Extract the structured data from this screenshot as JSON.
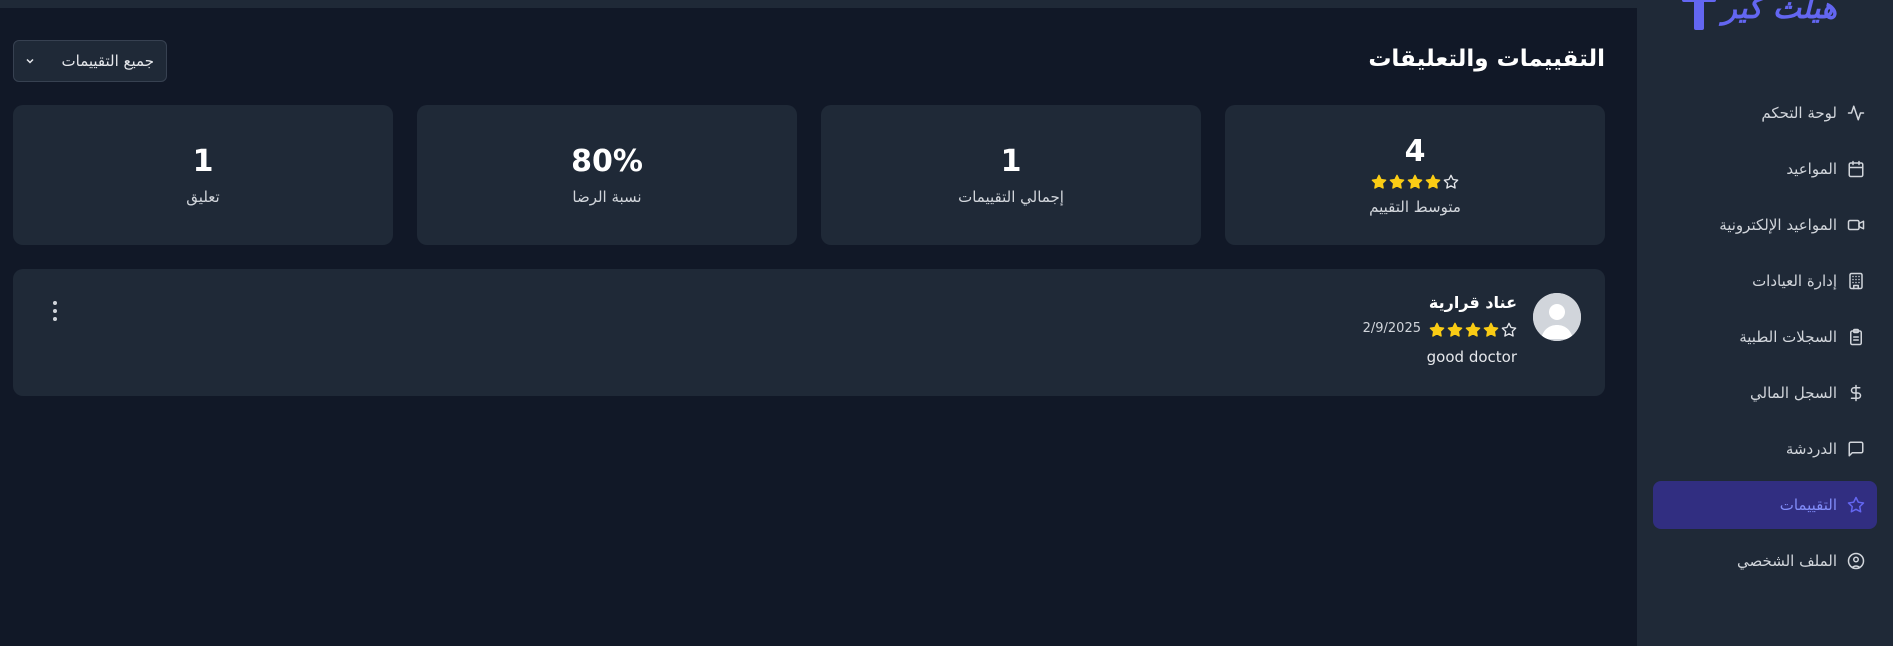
{
  "logo": {
    "text": "هيلث كير"
  },
  "sidebar": {
    "items": [
      {
        "label": "لوحة التحكم",
        "icon": "activity-icon",
        "active": false
      },
      {
        "label": "المواعيد",
        "icon": "calendar-icon",
        "active": false
      },
      {
        "label": "المواعيد الإلكترونية",
        "icon": "video-icon",
        "active": false
      },
      {
        "label": "إدارة العيادات",
        "icon": "building-icon",
        "active": false
      },
      {
        "label": "السجلات الطبية",
        "icon": "clipboard-icon",
        "active": false
      },
      {
        "label": "السجل المالي",
        "icon": "dollar-icon",
        "active": false
      },
      {
        "label": "الدردشة",
        "icon": "chat-icon",
        "active": false
      },
      {
        "label": "التقييمات",
        "icon": "star-icon",
        "active": true
      },
      {
        "label": "الملف الشخصي",
        "icon": "user-circle-icon",
        "active": false
      }
    ]
  },
  "page": {
    "title": "التقييمات والتعليقات",
    "filter": {
      "selected": "جميع التقييمات"
    }
  },
  "stats": {
    "average": {
      "value": "4",
      "label": "متوسط التقييم",
      "stars_filled": 4,
      "stars_total": 5
    },
    "total": {
      "value": "1",
      "label": "إجمالي التقييمات"
    },
    "satisfaction": {
      "value": "80%",
      "label": "نسبة الرضا"
    },
    "comments": {
      "value": "1",
      "label": "تعليق"
    }
  },
  "reviews": [
    {
      "name": "عناد قرارية",
      "date": "2/9/2025",
      "stars_filled": 4,
      "stars_total": 5,
      "text": "good doctor"
    }
  ],
  "colors": {
    "accent": "#6366f1",
    "star": "#facc15",
    "background": "#111827",
    "card": "#1f2937"
  }
}
